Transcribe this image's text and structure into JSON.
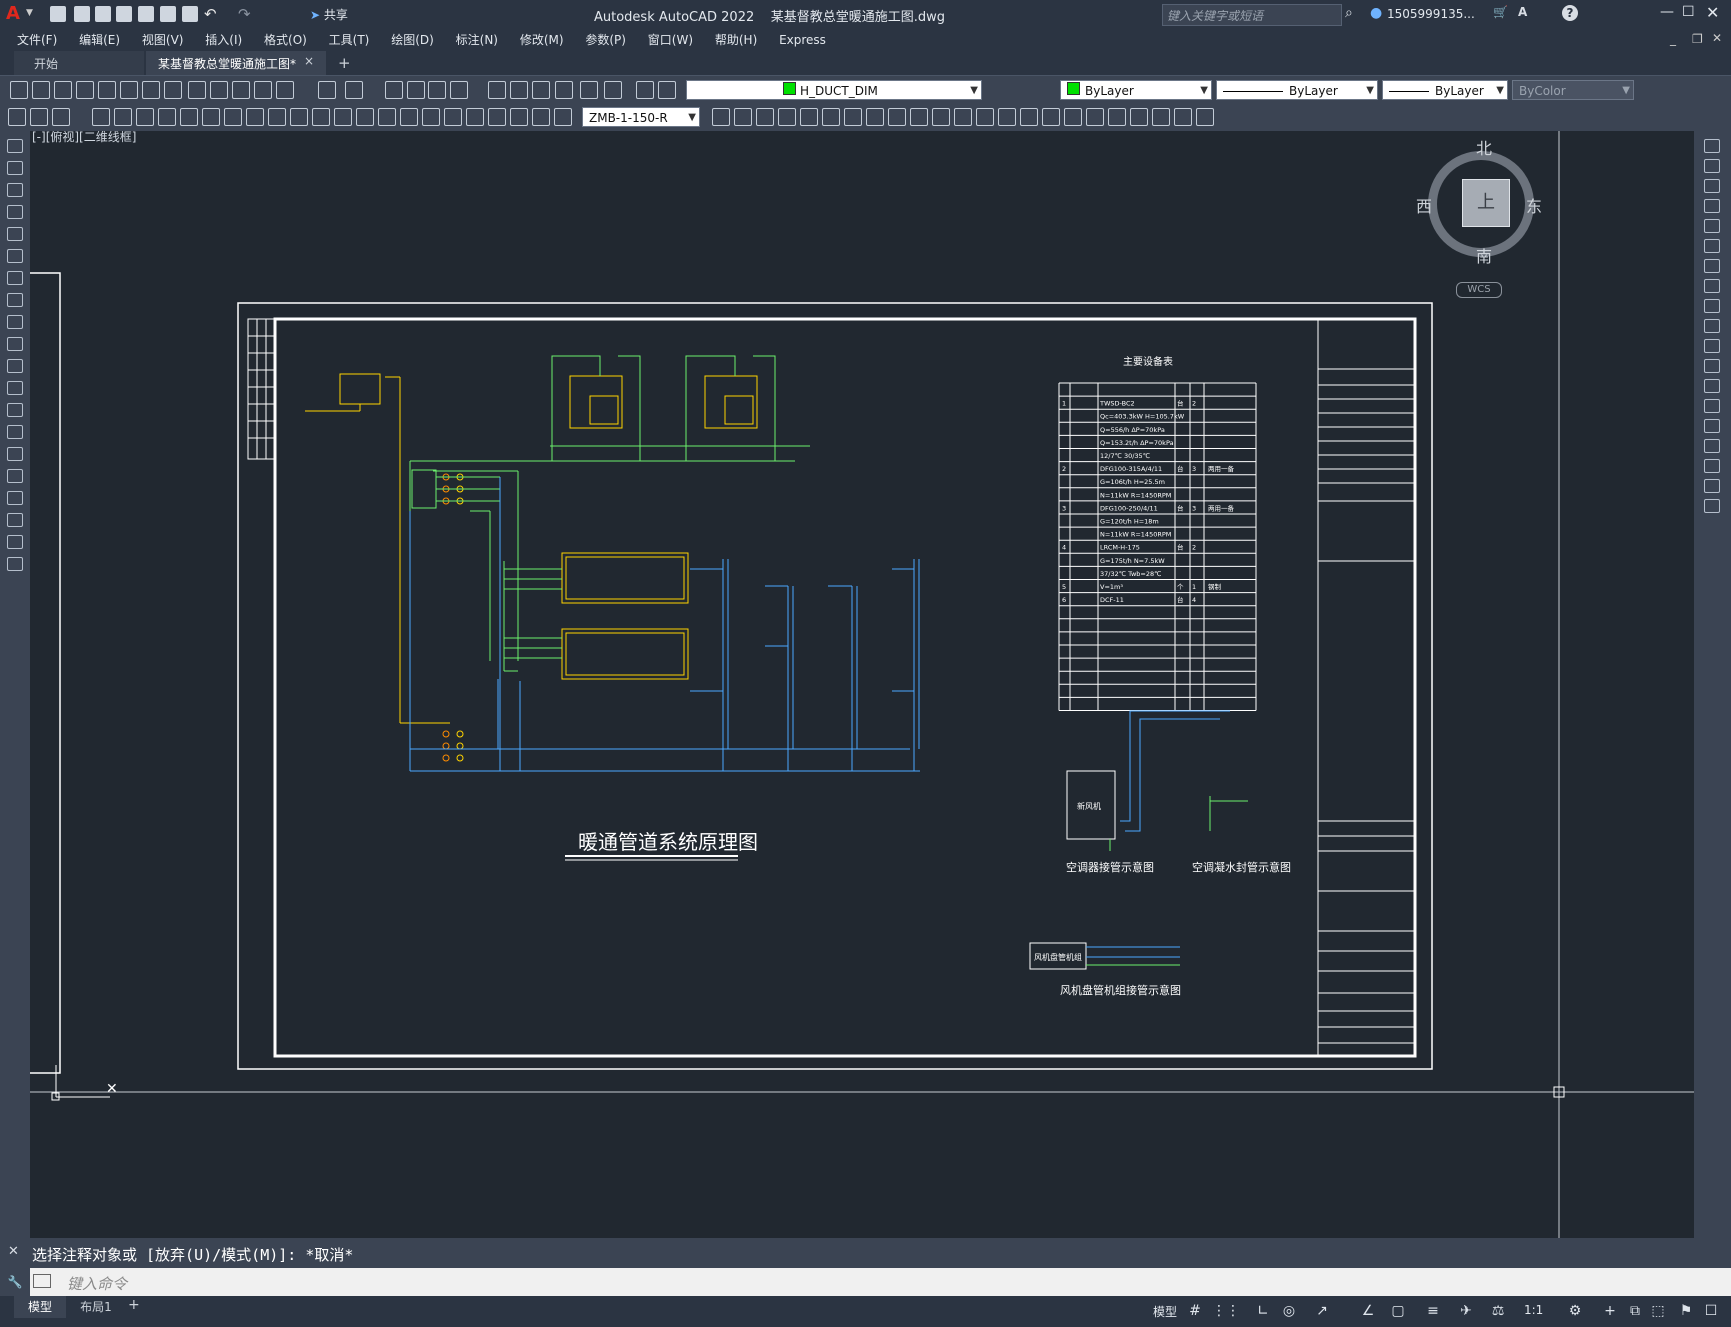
{
  "app": {
    "title": "Autodesk AutoCAD 2022    某基督教总堂暖通施工图.dwg",
    "search_placeholder": "键入关键字或短语",
    "user": "1505999135...",
    "share": "共享"
  },
  "menu": [
    "文件(F)",
    "编辑(E)",
    "视图(V)",
    "插入(I)",
    "格式(O)",
    "工具(T)",
    "绘图(D)",
    "标注(N)",
    "修改(M)",
    "参数(P)",
    "窗口(W)",
    "帮助(H)",
    "Express"
  ],
  "tabs": {
    "start": "开始",
    "active": "某基督教总堂暖通施工图*",
    "close": "×",
    "add": "+"
  },
  "properties": {
    "layer": "H_DUCT_DIM",
    "color": "ByLayer",
    "linetype": "ByLayer",
    "lineweight": "ByLayer",
    "plotstyle": "ByColor",
    "dimstyle": "ZMB-1-150-R"
  },
  "viewport_label": "[-][俯视][二维线框]",
  "viewcube": {
    "north": "北",
    "south": "南",
    "east": "东",
    "west": "西",
    "top": "上",
    "wcs": "WCS"
  },
  "drawing": {
    "main_title": "暖通管道系统原理图",
    "equipment_table_title": "主要设备表",
    "equipment_rows": [
      [
        "1",
        "",
        "TWSD-BC2",
        "台",
        "2",
        ""
      ],
      [
        "",
        "",
        "Qc=403.3kW  H=105.7kW",
        "",
        "",
        ""
      ],
      [
        "",
        "",
        "Q=556/h  ΔP=70kPa",
        "",
        "",
        ""
      ],
      [
        "",
        "",
        "Q=153.2t/h  ΔP=70kPa",
        "",
        "",
        ""
      ],
      [
        "",
        "",
        "12/7℃   30/35℃",
        "",
        "",
        ""
      ],
      [
        "2",
        "",
        "DFG100-315A/4/11",
        "台",
        "3",
        "两用一备"
      ],
      [
        "",
        "",
        "G=106t/h  H=25.5m",
        "",
        "",
        ""
      ],
      [
        "",
        "",
        "N=11kW  R=1450RPM",
        "",
        "",
        ""
      ],
      [
        "3",
        "",
        "DFG100-250/4/11",
        "台",
        "3",
        "两用一备"
      ],
      [
        "",
        "",
        "G=120t/h  H=18m",
        "",
        "",
        ""
      ],
      [
        "",
        "",
        "N=11kW  R=1450RPM",
        "",
        "",
        ""
      ],
      [
        "4",
        "",
        "LRCM-H-175",
        "台",
        "2",
        ""
      ],
      [
        "",
        "",
        "G=175t/h  N=7.5kW",
        "",
        "",
        ""
      ],
      [
        "",
        "",
        "37/32℃  Twb=28℃",
        "",
        "",
        ""
      ],
      [
        "5",
        "",
        "V=1m³",
        "个",
        "1",
        "钢制"
      ],
      [
        "6",
        "",
        "DCF-11",
        "台",
        "4",
        ""
      ]
    ],
    "sub1": "空调器接管示意图",
    "sub2": "空调凝水封管示意图",
    "sub3": "风机盘管机组接管示意图",
    "sub1_box": "新风机",
    "sub3_box": "风机盘管机组"
  },
  "command": {
    "history": "选择注释对象或 [放弃(U)/模式(M)]: *取消*",
    "placeholder": "键入命令"
  },
  "layout_tabs": {
    "model": "模型",
    "layout1": "布局1",
    "add": "+"
  },
  "status": {
    "model": "模型",
    "scale": "1:1"
  }
}
